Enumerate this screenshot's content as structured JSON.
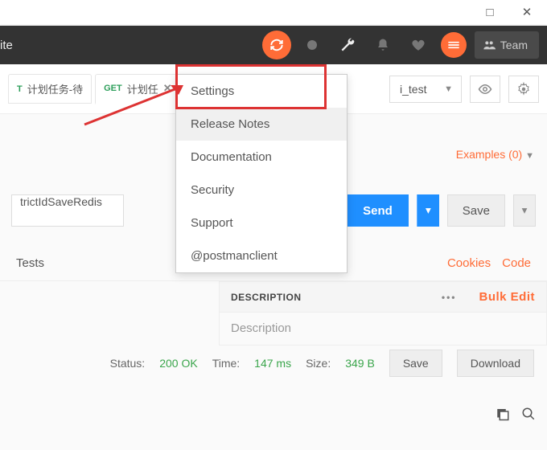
{
  "window": {
    "maximize": "□",
    "close": "✕"
  },
  "topbar": {
    "invite": "ite",
    "team": "Team"
  },
  "tabs": [
    {
      "method": "T",
      "label": "计划任务-待"
    },
    {
      "method": "GET",
      "label": "计划任",
      "closable": true
    }
  ],
  "env": {
    "selected": "i_test"
  },
  "wrench_menu": {
    "items": [
      "Settings",
      "Release Notes",
      "Documentation",
      "Security",
      "Support",
      "@postmanclient"
    ],
    "highlighted": "Release Notes",
    "boxed": "Settings"
  },
  "examples": {
    "label": "Examples (0)"
  },
  "request": {
    "url_fragment": "trictIdSaveRedis",
    "send": "Send",
    "save": "Save"
  },
  "subtabs": {
    "tests": "Tests",
    "cookies": "Cookies",
    "code": "Code"
  },
  "desc": {
    "header": "DESCRIPTION",
    "bulk": "Bulk Edit",
    "placeholder": "Description"
  },
  "status": {
    "status_label": "Status:",
    "status_value": "200 OK",
    "time_label": "Time:",
    "time_value": "147 ms",
    "size_label": "Size:",
    "size_value": "349 B",
    "save": "Save",
    "download": "Download"
  }
}
